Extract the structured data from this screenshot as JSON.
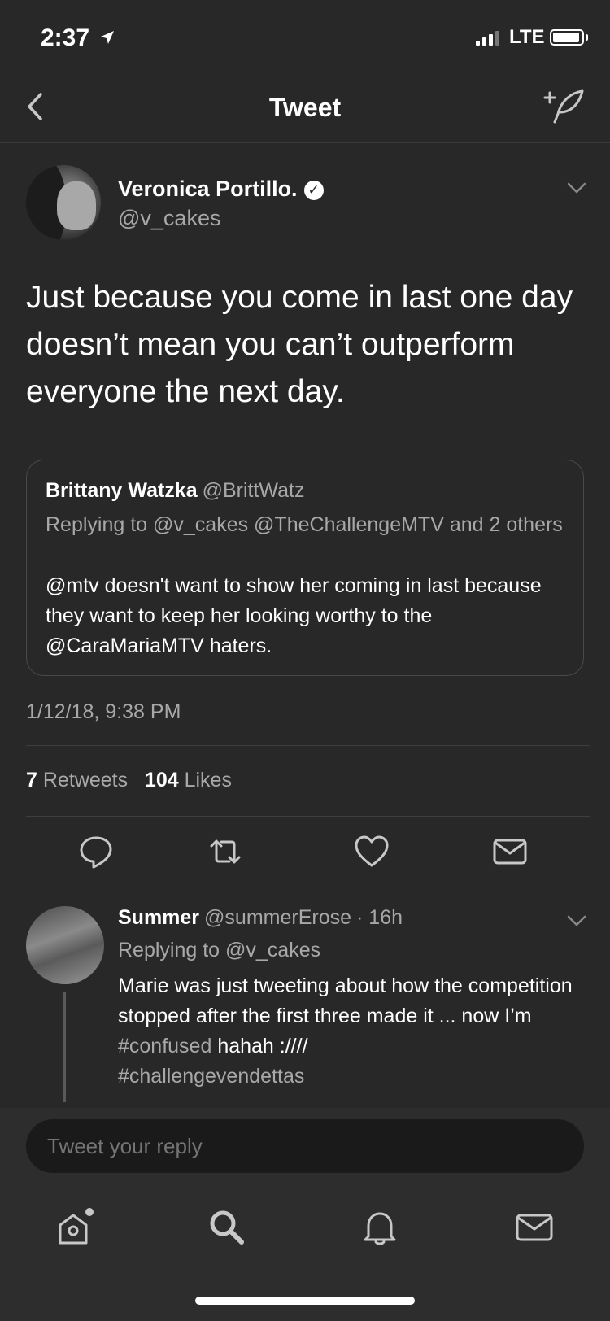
{
  "status_bar": {
    "time": "2:37",
    "carrier": "LTE"
  },
  "navbar": {
    "title": "Tweet",
    "back_icon": "chevron-left-icon",
    "compose_icon": "compose-tweet-icon"
  },
  "tweet": {
    "author_name": "Veronica Portillo.",
    "handle": "@v_cakes",
    "text": "Just because you come in last one day doesn’t mean you can’t outperform everyone the next day.",
    "quote": {
      "author_name": "Brittany Watzka",
      "handle": "@BrittWatz",
      "replying_to": "Replying to @v_cakes @TheChallengeMTV and 2 others",
      "text": "@mtv doesn't want to show her coming in last because they want to keep her looking worthy to the @CaraMariaMTV haters."
    },
    "timestamp": "1/12/18, 9:38 PM",
    "retweets_count": "7",
    "retweets_label": "Retweets",
    "likes_count": "104",
    "likes_label": "Likes"
  },
  "reply": {
    "author_name": "Summer",
    "handle": "@summerErose",
    "time": "· 16h",
    "replying_to": "Replying to @v_cakes",
    "text_before": "Marie was just tweeting about how the competition stopped after the first three made it ... now I’m ",
    "hashtag1": "#confused",
    "text_after": " hahah :////",
    "hashtag2": "#challengevendettas"
  },
  "compose": {
    "placeholder": "Tweet your reply"
  },
  "tabs": [
    {
      "icon": "home-icon"
    },
    {
      "icon": "search-icon"
    },
    {
      "icon": "bell-icon"
    },
    {
      "icon": "mail-icon"
    }
  ]
}
